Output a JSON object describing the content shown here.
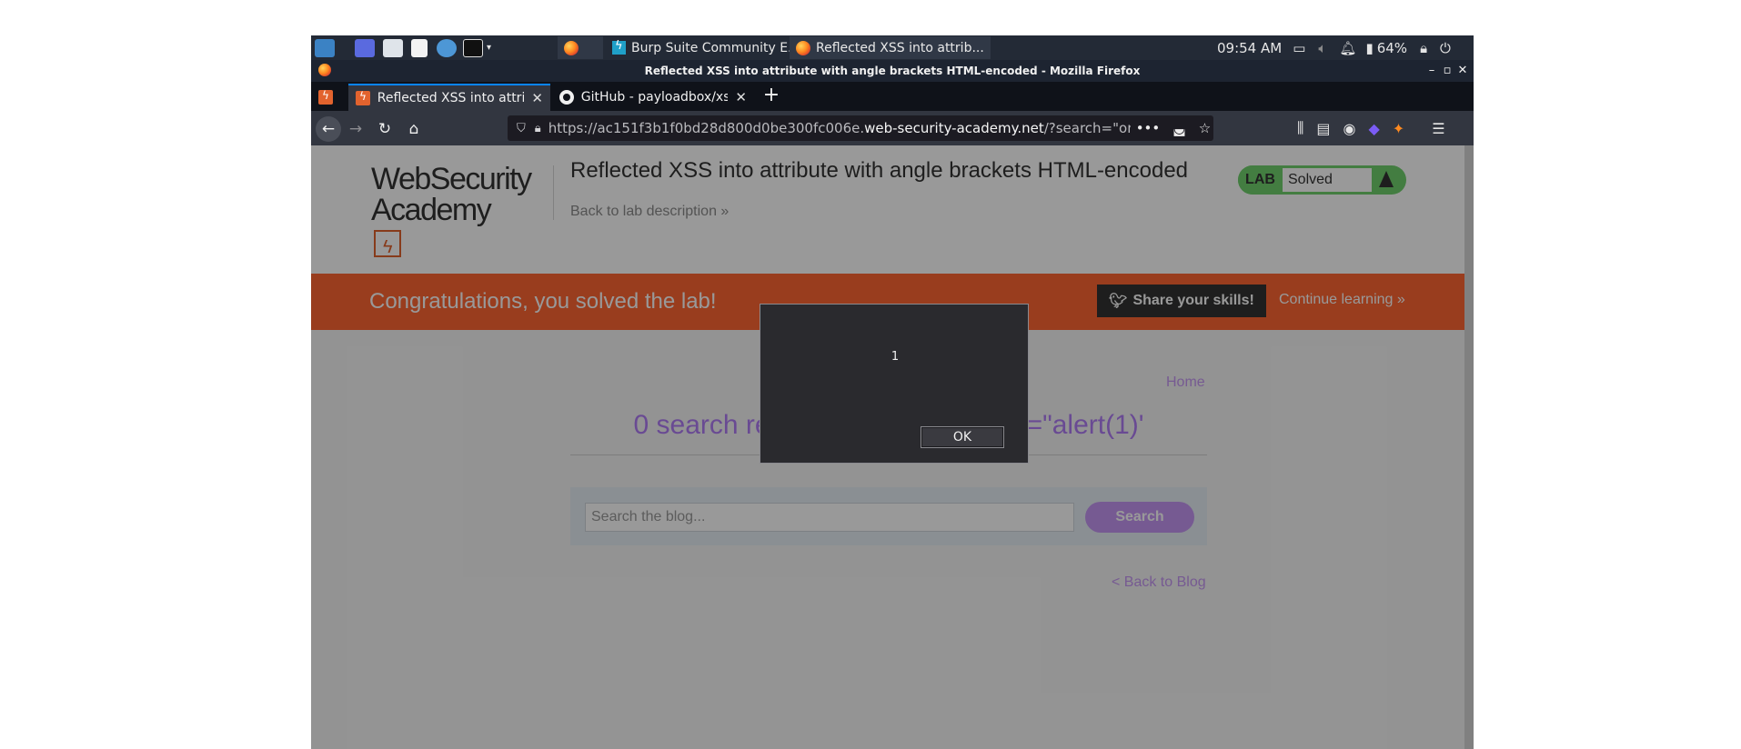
{
  "taskbar": {
    "tasks": [
      {
        "label": "Burp Suite Community E..."
      },
      {
        "label": "Reflected XSS into attrib..."
      }
    ],
    "clock": "09:54 AM",
    "battery": "64%"
  },
  "window": {
    "title": "Reflected XSS into attribute with angle brackets HTML-encoded - Mozilla Firefox"
  },
  "tabs": [
    {
      "label": "Reflected XSS into attrib"
    },
    {
      "label": "GitHub - payloadbox/xss"
    }
  ],
  "urlbar": {
    "prefix": "https://ac151f3b1f0bd28d800d0be300fc006e.",
    "host": "web-security-academy.net",
    "suffix": "/?search=\"onmou"
  },
  "page": {
    "logo_line1": "WebSecurity",
    "logo_line2": "Academy",
    "lab_title": "Reflected XSS into attribute with angle brackets HTML-encoded",
    "back_to_description": "Back to lab description »",
    "lab_badge_label": "LAB",
    "lab_status": "Solved",
    "congrats_message": "Congratulations, you solved the lab!",
    "share_button": "Share your skills!",
    "continue_learning": "Continue learning »",
    "home_link": "Home",
    "results_heading_left": "0 search re",
    "results_heading_right": "r=\"alert(1)'",
    "search_placeholder": "Search the blog...",
    "search_button": "Search",
    "back_to_blog": "< Back to Blog"
  },
  "dialog": {
    "message": "1",
    "ok_label": "OK"
  },
  "colors": {
    "accent_orange": "#ff6633",
    "lab_green": "#70d16d",
    "link_purple": "#c596f3"
  }
}
